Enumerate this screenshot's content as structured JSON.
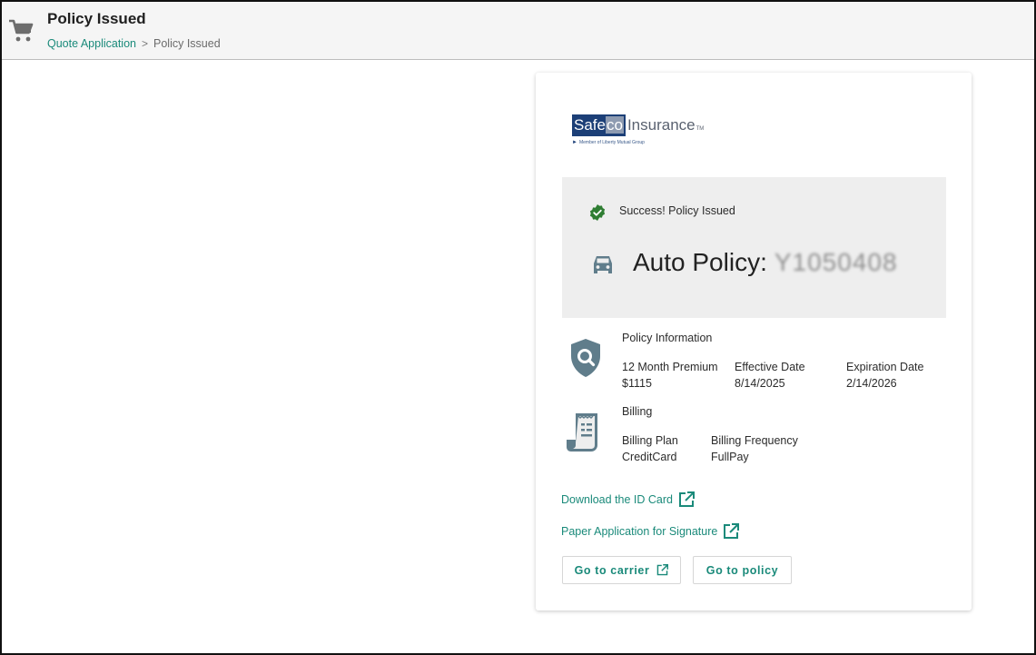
{
  "header": {
    "title": "Policy Issued",
    "breadcrumb": {
      "link": "Quote Application",
      "separator": ">",
      "current": "Policy Issued"
    },
    "icon": "cart-icon"
  },
  "carrier_logo": {
    "brand_part1": "Safe",
    "brand_part2": "co",
    "brand_word": "Insurance",
    "trademark": "TM",
    "tagline": "Member of Liberty Mutual Group"
  },
  "status": {
    "message": "Success! Policy Issued",
    "icon": "verified-check-icon",
    "policy_label": "Auto Policy:",
    "policy_number": "Y1050408",
    "policy_icon": "car-icon"
  },
  "policy_information": {
    "title": "Policy Information",
    "icon": "shield-search-icon",
    "fields": [
      {
        "label": "12 Month Premium",
        "value": "$1115"
      },
      {
        "label": "Effective Date",
        "value": "8/14/2025"
      },
      {
        "label": "Expiration Date",
        "value": "2/14/2026"
      }
    ]
  },
  "billing": {
    "title": "Billing",
    "icon": "receipt-icon",
    "fields": [
      {
        "label": "Billing Plan",
        "value": "CreditCard"
      },
      {
        "label": "Billing Frequency",
        "value": "FullPay"
      }
    ]
  },
  "links": {
    "download_id_card": "Download the ID Card",
    "paper_application": "Paper Application for Signature"
  },
  "buttons": {
    "go_to_carrier": "Go to carrier",
    "go_to_policy": "Go to policy"
  },
  "colors": {
    "accent": "#1a8a7a",
    "success": "#2e7d32",
    "icon_gray": "#607d8b",
    "panel": "#eeeeee"
  }
}
